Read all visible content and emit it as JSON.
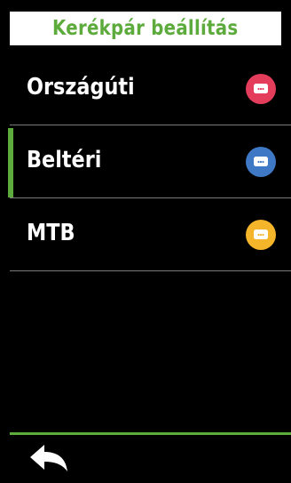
{
  "header": {
    "title": "Kerékpár beállítás"
  },
  "bikes": [
    {
      "label": "Országúti",
      "icon": "bike-speedometer-icon",
      "icon_color": "#e43d5c",
      "selected": false
    },
    {
      "label": "Beltéri",
      "icon": "bike-speedometer-icon",
      "icon_color": "#3f78c4",
      "selected": true
    },
    {
      "label": "MTB",
      "icon": "bike-speedometer-icon",
      "icon_color": "#f5b52b",
      "selected": false
    }
  ],
  "footer": {
    "back_icon": "back-arrow-icon"
  },
  "colors": {
    "accent": "#5cab3c",
    "background": "#000000",
    "separator": "#7a7a7a"
  }
}
